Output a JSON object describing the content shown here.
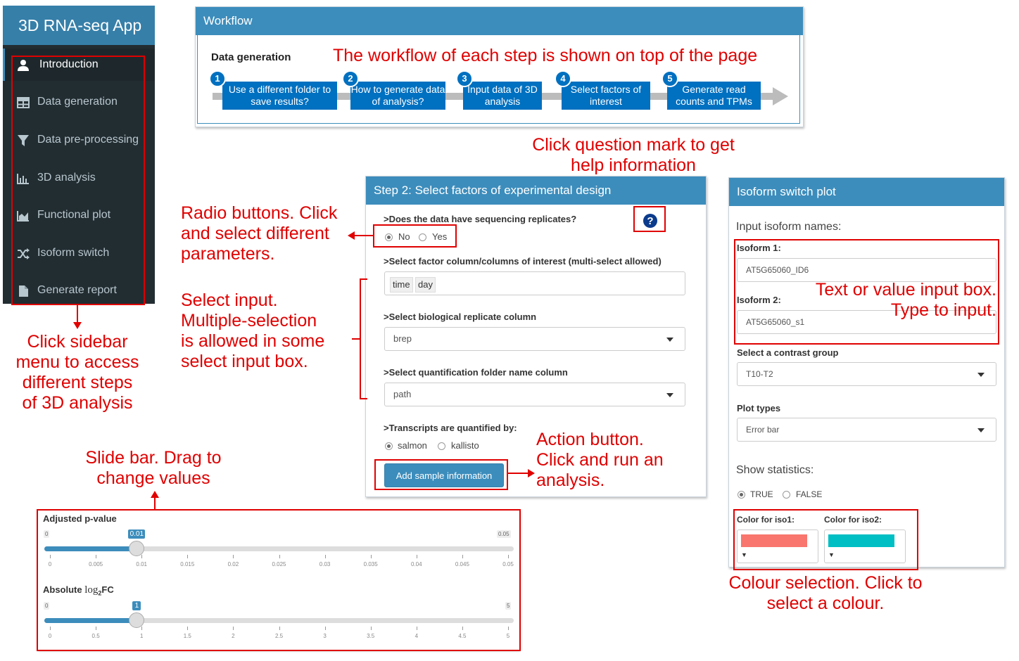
{
  "sidebar": {
    "title": "3D RNA-seq App",
    "items": [
      {
        "label": "Introduction",
        "icon": "user-icon",
        "active": true
      },
      {
        "label": "Data generation",
        "icon": "table-icon"
      },
      {
        "label": "Data pre-processing",
        "icon": "filter-icon"
      },
      {
        "label": "3D analysis",
        "icon": "bar-chart-icon"
      },
      {
        "label": "Functional plot",
        "icon": "area-chart-icon"
      },
      {
        "label": "Isoform switch",
        "icon": "random-icon"
      },
      {
        "label": "Generate report",
        "icon": "file-icon"
      }
    ]
  },
  "workflow": {
    "title": "Workflow",
    "section": "Data generation",
    "steps": [
      {
        "num": "1",
        "label": "Use a different folder to save results?"
      },
      {
        "num": "2",
        "label": "How to generate data of analysis?"
      },
      {
        "num": "3",
        "label": "Input data of 3D analysis"
      },
      {
        "num": "4",
        "label": "Select factors of interest"
      },
      {
        "num": "5",
        "label": "Generate read counts and TPMs"
      }
    ]
  },
  "step2": {
    "title": "Step 2: Select factors of experimental design",
    "replicates_label": ">Does the data have sequencing replicates?",
    "replicates_options": [
      "No",
      "Yes"
    ],
    "replicates_selected": "No",
    "factor_label": ">Select factor column/columns of interest (multi-select allowed)",
    "factor_values": [
      "time",
      "day"
    ],
    "brep_label": ">Select biological replicate column",
    "brep_value": "brep",
    "path_label": ">Select quantification folder name column",
    "path_value": "path",
    "quant_label": ">Transcripts are quantified by:",
    "quant_options": [
      "salmon",
      "kallisto"
    ],
    "quant_selected": "salmon",
    "button_label": "Add sample information",
    "help_icon": "question-circle-icon"
  },
  "isoform": {
    "title": "Isoform switch plot",
    "input_label": "Input isoform names:",
    "iso1_label": "Isoform 1:",
    "iso1_value": "AT5G65060_ID6",
    "iso2_label": "Isoform 2:",
    "iso2_value": "AT5G65060_s1",
    "contrast_label": "Select a contrast group",
    "contrast_value": "T10-T2",
    "plot_label": "Plot types",
    "plot_value": "Error bar",
    "stats_label": "Show statistics:",
    "stats_options": [
      "TRUE",
      "FALSE"
    ],
    "stats_selected": "TRUE",
    "color1_label": "Color for iso1:",
    "color1": "#f8766d",
    "color2_label": "Color for iso2:",
    "color2": "#00bfc4"
  },
  "sliders": {
    "pvalue": {
      "label": "Adjusted p-value",
      "min": "0",
      "max": "0.05",
      "value": "0.01",
      "fraction": 0.2,
      "ticks": [
        "0",
        "0.005",
        "0.01",
        "0.015",
        "0.02",
        "0.025",
        "0.03",
        "0.035",
        "0.04",
        "0.045",
        "0.05"
      ]
    },
    "lfc": {
      "label_pre": "Absolute ",
      "label_log": "log",
      "label_sub": "2",
      "label_post": "FC",
      "min": "0",
      "max": "5",
      "value": "1",
      "fraction": 0.2,
      "ticks": [
        "0",
        "0.5",
        "1",
        "1.5",
        "2",
        "2.5",
        "3",
        "3.5",
        "4",
        "4.5",
        "5"
      ]
    }
  },
  "annotations": {
    "workflow_note": "The workflow of each step is shown on top of the page",
    "help_note": "Click question mark to get\nhelp information",
    "radio_note": "Radio buttons. Click\nand select different\nparameters.",
    "select_note": "Select input.\nMultiple-selection\nis allowed in some\nselect input box.",
    "sidebar_note": "Click sidebar\nmenu to access\ndifferent steps\nof 3D analysis",
    "slider_note": "Slide bar. Drag to\nchange values",
    "action_note": "Action button.\nClick and run an\nanalysis.",
    "text_note": "Text or value input box.\nType to input.",
    "colour_note": "Colour selection. Click to\nselect a colour."
  },
  "colors": {
    "accent": "#3c8dbc",
    "annotation": "#e00000",
    "sidebar": "#222d32",
    "step": "#0070c0"
  }
}
